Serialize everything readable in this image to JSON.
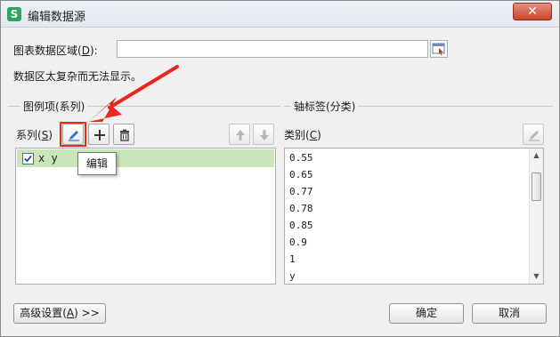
{
  "window": {
    "title": "编辑数据源",
    "app_icon_letter": "S",
    "close_symbol": "✕"
  },
  "data_range": {
    "label_prefix": "图表数据区域(",
    "label_key": "D",
    "label_suffix": "):",
    "value": "",
    "message": "数据区太复杂而无法显示。"
  },
  "series_panel": {
    "group_title": "图例项(系列)",
    "label_prefix": "系列(",
    "label_key": "S",
    "label_suffix": ")",
    "items": [
      {
        "label": "x y",
        "checked": true
      }
    ],
    "tooltip": "编辑"
  },
  "category_panel": {
    "group_title": "轴标签(分类)",
    "label_prefix": "类别(",
    "label_key": "C",
    "label_suffix": ")",
    "items": [
      "0.55",
      "0.65",
      "0.77",
      "0.78",
      "0.85",
      "0.9",
      "1",
      "y"
    ]
  },
  "footer": {
    "advanced_prefix": "高级设置(",
    "advanced_key": "A",
    "advanced_suffix": ") >>",
    "ok_label": "确定",
    "cancel_label": "取消"
  },
  "colors": {
    "highlight": "#e8281e",
    "selected_row": "#c9e6b8",
    "app_icon": "#2ea55a"
  }
}
